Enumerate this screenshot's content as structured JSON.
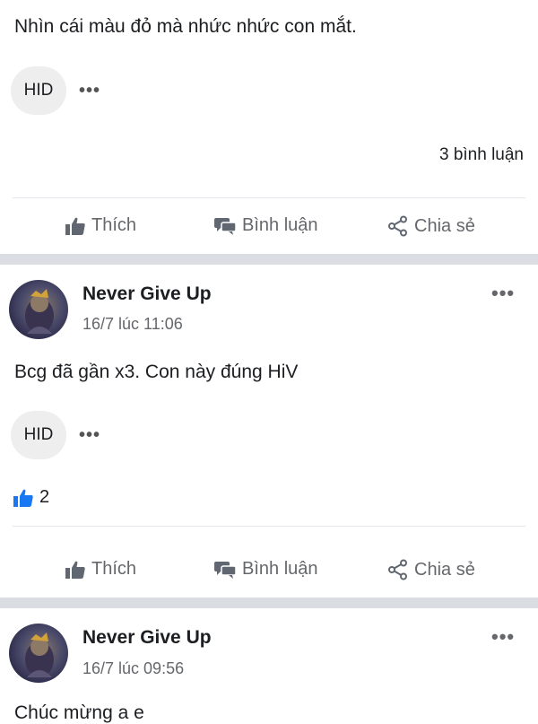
{
  "post1": {
    "text": "Nhìn cái màu đỏ mà nhức nhức con mắt.",
    "reaction_chip": "HID",
    "more_reactions": "•••",
    "comment_count": "3 bình luận"
  },
  "actions": {
    "like": "Thích",
    "comment": "Bình luận",
    "share": "Chia sẻ"
  },
  "post2": {
    "author": "Never Give Up",
    "time": "16/7 lúc 11:06",
    "options": "•••",
    "text": "Bcg đã gần x3. Con này đúng HiV",
    "reaction_chip": "HID",
    "more_reactions": "•••",
    "like_count": "2"
  },
  "post3": {
    "author": "Never Give Up",
    "time": "16/7 lúc 09:56",
    "options": "•••",
    "text": "Chúc mừng a e"
  },
  "colors": {
    "like_blue": "#1877f2",
    "separator": "#dadde1",
    "muted_text": "#65676b"
  }
}
